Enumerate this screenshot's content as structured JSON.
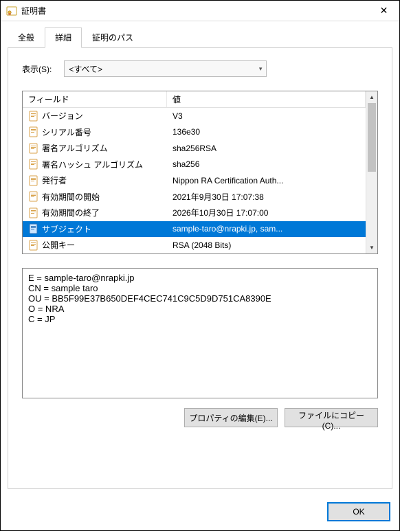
{
  "window": {
    "title": "証明書",
    "close_label": "✕"
  },
  "tabs": {
    "general": "全般",
    "details": "詳細",
    "path": "証明のパス"
  },
  "filter": {
    "label": "表示(S):",
    "selected": "<すべて>"
  },
  "list": {
    "headers": {
      "field": "フィールド",
      "value": "値"
    },
    "rows": [
      {
        "field": "バージョン",
        "value": "V3",
        "selected": false
      },
      {
        "field": "シリアル番号",
        "value": "136e30",
        "selected": false
      },
      {
        "field": "署名アルゴリズム",
        "value": "sha256RSA",
        "selected": false
      },
      {
        "field": "署名ハッシュ アルゴリズム",
        "value": "sha256",
        "selected": false
      },
      {
        "field": "発行者",
        "value": "Nippon RA Certification Auth...",
        "selected": false
      },
      {
        "field": "有効期間の開始",
        "value": "2021年9月30日 17:07:38",
        "selected": false
      },
      {
        "field": "有効期間の終了",
        "value": "2026年10月30日 17:07:00",
        "selected": false
      },
      {
        "field": "サブジェクト",
        "value": "sample-taro@nrapki.jp, sam...",
        "selected": true
      },
      {
        "field": "公開キー",
        "value": "RSA (2048 Bits)",
        "selected": false
      }
    ]
  },
  "detail_text": "E = sample-taro@nrapki.jp\nCN = sample taro\nOU = BB5F99E37B650DEF4CEC741C9C5D9D751CA8390E\nO = NRA\nC = JP",
  "buttons": {
    "edit_props": "プロパティの編集(E)...",
    "copy_file": "ファイルにコピー(C)...",
    "ok": "OK"
  }
}
